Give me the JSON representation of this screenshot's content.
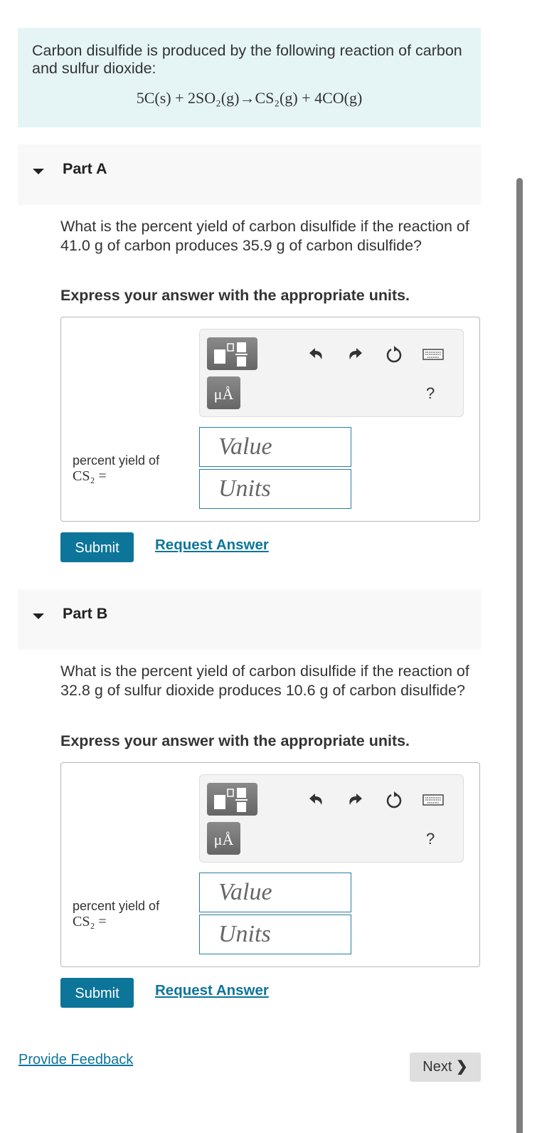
{
  "intro": {
    "text": "Carbon disulfide is produced by the following reaction of carbon and sulfur dioxide:",
    "equation": "5C(s) + 2SO₂(g)→CS₂(g) + 4CO(g)"
  },
  "parts": [
    {
      "title": "Part A",
      "question": "What is the percent yield of carbon disulfide if the reaction of 41.0 g of carbon produces 35.9 g of carbon disulfide?",
      "instruction": "Express your answer with the appropriate units.",
      "label_line1": "percent yield of",
      "label_line2": "CS₂ =",
      "value_placeholder": "Value",
      "units_placeholder": "Units",
      "submit_label": "Submit",
      "request_label": "Request Answer"
    },
    {
      "title": "Part B",
      "question": "What is the percent yield of carbon disulfide if the reaction of 32.8 g of sulfur dioxide produces 10.6 g of carbon disulfide?",
      "instruction": "Express your answer with the appropriate units.",
      "label_line1": "percent yield of",
      "label_line2": "CS₂ =",
      "value_placeholder": "Value",
      "units_placeholder": "Units",
      "submit_label": "Submit",
      "request_label": "Request Answer"
    }
  ],
  "toolbar": {
    "templates_icon": "fraction-template-icon",
    "units_label": "μÅ",
    "undo_icon": "undo-icon",
    "redo_icon": "redo-icon",
    "reset_icon": "reset-icon",
    "keyboard_icon": "keyboard-icon",
    "help_label": "?"
  },
  "footer": {
    "feedback_label": "Provide Feedback",
    "next_label": "Next",
    "next_icon": "❯"
  },
  "colors": {
    "accent": "#0d7599",
    "intro_bg": "#e5f5f6",
    "part_header_bg": "#f8f8f8"
  }
}
